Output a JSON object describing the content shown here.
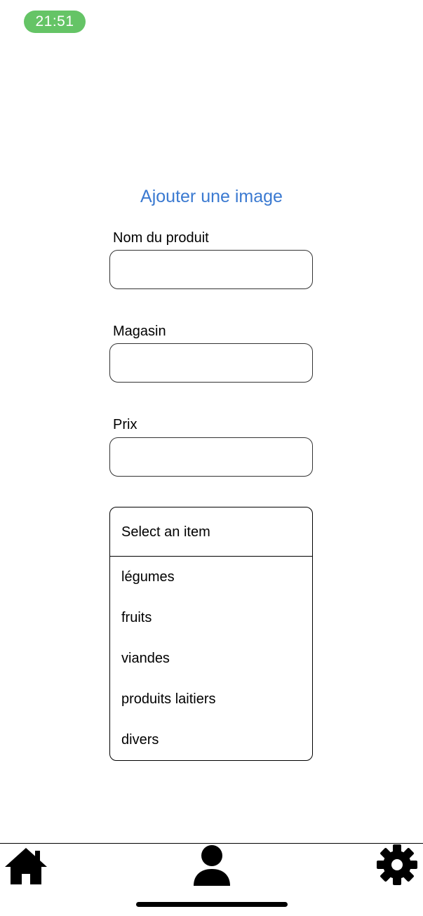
{
  "status_bar": {
    "time": "21:51",
    "time_pill_color": "#65c466"
  },
  "form": {
    "add_image_label": "Ajouter une image",
    "add_image_color": "#3b7ad1",
    "product_name": {
      "label": "Nom du produit",
      "value": "",
      "placeholder": ""
    },
    "store": {
      "label": "Magasin",
      "value": "",
      "placeholder": ""
    },
    "price": {
      "label": "Prix",
      "value": "",
      "placeholder": ""
    }
  },
  "category_dropdown": {
    "selected": "Select an item",
    "options": [
      "légumes",
      "fruits",
      "viandes",
      "produits laitiers",
      "divers"
    ]
  },
  "tab_bar": {
    "tabs": [
      {
        "icon": "home-icon"
      },
      {
        "icon": "user-icon"
      },
      {
        "icon": "gear-icon"
      }
    ]
  }
}
